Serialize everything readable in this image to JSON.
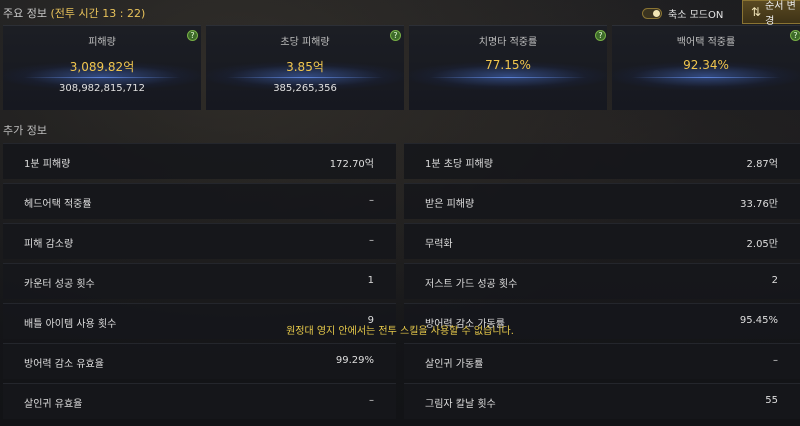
{
  "header": {
    "title_prefix": "주요 정보",
    "battle_time": "(전투 시간 13 : 22)",
    "compact_mode_label": "축소 모드ON",
    "order_button_label": "순서 변경"
  },
  "stats": [
    {
      "label": "피해량",
      "value": "3,089.82억",
      "sub": "308,982,815,712"
    },
    {
      "label": "초당 피해량",
      "value": "3.85억",
      "sub": "385,265,356"
    },
    {
      "label": "치명타 적중률",
      "value": "77.15%",
      "sub": ""
    },
    {
      "label": "백어택 적중률",
      "value": "92.34%",
      "sub": ""
    }
  ],
  "additional": {
    "title": "추가 정보",
    "left": [
      {
        "label": "1분 피해량",
        "value": "172.70억"
      },
      {
        "label": "헤드어택 적중률",
        "value": "–"
      },
      {
        "label": "피해 감소량",
        "value": "–"
      },
      {
        "label": "카운터 성공 횟수",
        "value": "1"
      },
      {
        "label": "배틀 아이템 사용 횟수",
        "value": "9"
      },
      {
        "label": "방어력 감소 유효율",
        "value": "99.29%"
      },
      {
        "label": "살인귀 유효율",
        "value": "–"
      }
    ],
    "right": [
      {
        "label": "1분 초당 피해량",
        "value": "2.87억"
      },
      {
        "label": "받은 피해량",
        "value": "33.76만"
      },
      {
        "label": "무력화",
        "value": "2.05만"
      },
      {
        "label": "저스트 가드 성공 횟수",
        "value": "2"
      },
      {
        "label": "방어력 감소 가동률",
        "value": "95.45%"
      },
      {
        "label": "살인귀 가동률",
        "value": "–"
      },
      {
        "label": "그림자 칼날 횟수",
        "value": "55"
      }
    ]
  },
  "notice": "원정대 영지 안에서는 전투 스킬을 사용할 수 없습니다.",
  "icons": {
    "help": "question-icon",
    "order": "swap-icon"
  },
  "colors": {
    "accent": "#f1c64e",
    "help_green": "#78b046"
  }
}
